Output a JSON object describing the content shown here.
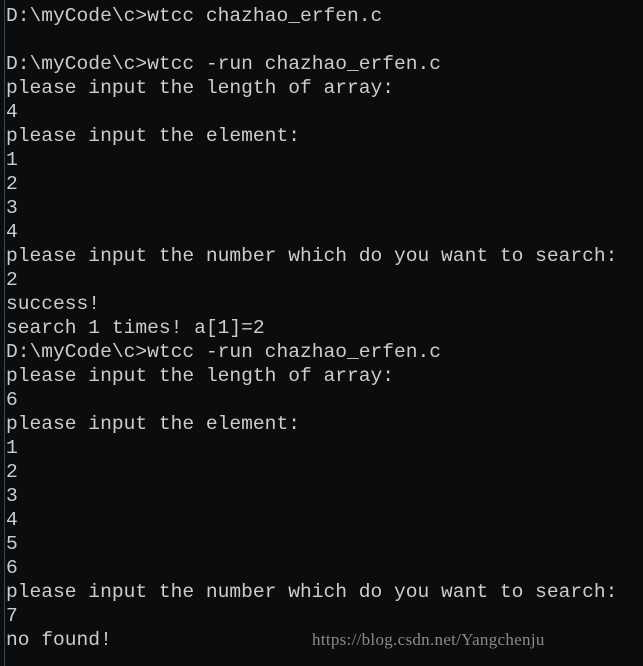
{
  "colors": {
    "background": "#0c0c0c",
    "text": "#cccccc",
    "watermark": "#8a8a8a"
  },
  "lines": [
    "D:\\myCode\\c>wtcc chazhao_erfen.c",
    "",
    "D:\\myCode\\c>wtcc -run chazhao_erfen.c",
    "please input the length of array:",
    "4",
    "please input the element:",
    "1",
    "2",
    "3",
    "4",
    "please input the number which do you want to search:",
    "2",
    "success!",
    "search 1 times! a[1]=2",
    "D:\\myCode\\c>wtcc -run chazhao_erfen.c",
    "please input the length of array:",
    "6",
    "please input the element:",
    "1",
    "2",
    "3",
    "4",
    "5",
    "6",
    "please input the number which do you want to search:",
    "7",
    "no found!"
  ],
  "watermark": "https://blog.csdn.net/Yangchenju"
}
